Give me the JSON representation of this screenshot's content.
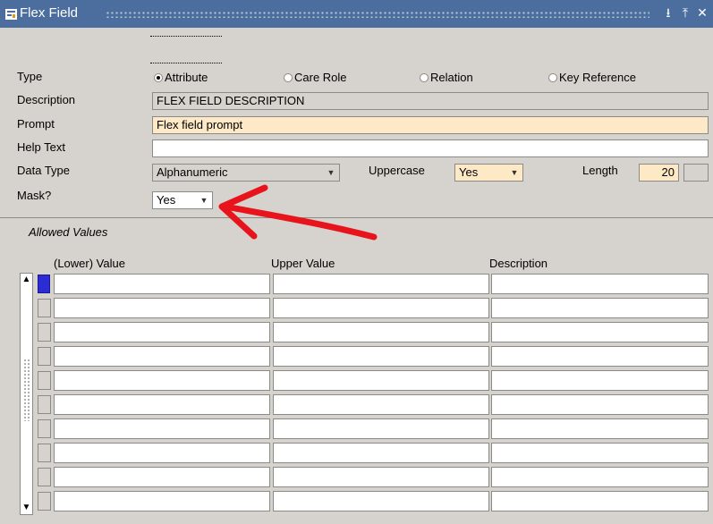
{
  "window": {
    "title": "Flex Field",
    "icon": "form-window-icon",
    "controls": [
      "minimize-icon",
      "maximize-icon",
      "close-icon"
    ]
  },
  "form": {
    "type_label": "Type",
    "type_options": [
      {
        "label": "Attribute",
        "selected": true
      },
      {
        "label": "Care Role",
        "selected": false
      },
      {
        "label": "Relation",
        "selected": false
      },
      {
        "label": "Key Reference",
        "selected": false
      }
    ],
    "description_label": "Description",
    "description_value": "FLEX FIELD DESCRIPTION",
    "prompt_label": "Prompt",
    "prompt_value": "Flex field prompt",
    "help_label": "Help Text",
    "help_value": "",
    "datatype_label": "Data Type",
    "datatype_value": "Alphanumeric",
    "uppercase_label": "Uppercase",
    "uppercase_value": "Yes",
    "length_label": "Length",
    "length_value": "20",
    "mask_label": "Mask?",
    "mask_value": "Yes"
  },
  "allowed_values": {
    "title": "Allowed Values",
    "columns": [
      "(Lower) Value",
      "Upper Value",
      "Description"
    ],
    "row_count": 10
  },
  "colors": {
    "titlebar": "#4b6e9e",
    "required_field": "#fde9c5",
    "annotation_arrow": "#e8141c",
    "current_row_marker": "#2c2cd6"
  }
}
